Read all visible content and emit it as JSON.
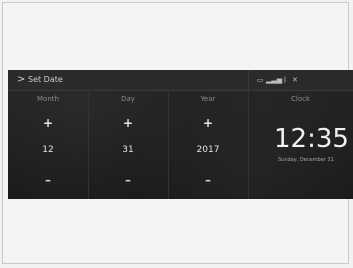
{
  "topbar": {
    "back_glyph": ">",
    "title": "Set Date",
    "status_icons": [
      "hands-free-phone-icon",
      "signal-bars-icon",
      "bluetooth-icon",
      "no-wifi-icon"
    ]
  },
  "columns": [
    {
      "id": "month",
      "header": "Month",
      "value": "12",
      "plus": "+",
      "minus": "–"
    },
    {
      "id": "day",
      "header": "Day",
      "value": "31",
      "plus": "+",
      "minus": "–"
    },
    {
      "id": "year",
      "header": "Year",
      "value": "2017",
      "plus": "+",
      "minus": "–"
    }
  ],
  "clock": {
    "header": "Clock",
    "time": "12:35",
    "date": "Sunday, December 31"
  },
  "colors": {
    "screen_bg": "#1f1f1f",
    "text": "#e6e6e6",
    "muted": "#8c8c8c"
  }
}
